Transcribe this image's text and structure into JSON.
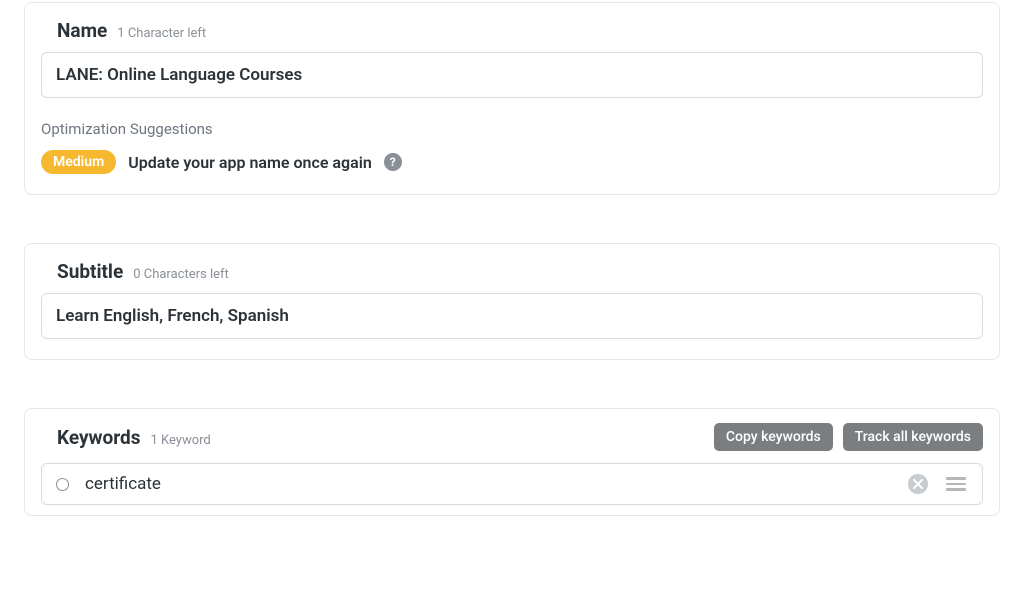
{
  "name_section": {
    "title": "Name",
    "hint": "1 Character left",
    "value": "LANE: Online Language Courses",
    "optimization_label": "Optimization Suggestions",
    "badge_text": "Medium",
    "suggestion_text": "Update your app name once again",
    "help_glyph": "?"
  },
  "subtitle_section": {
    "title": "Subtitle",
    "hint": "0 Characters left",
    "value": "Learn English, French, Spanish"
  },
  "keywords_section": {
    "title": "Keywords",
    "hint": "1 Keyword",
    "copy_button": "Copy keywords",
    "track_button": "Track all keywords",
    "items": [
      {
        "text": "certificate"
      }
    ]
  }
}
